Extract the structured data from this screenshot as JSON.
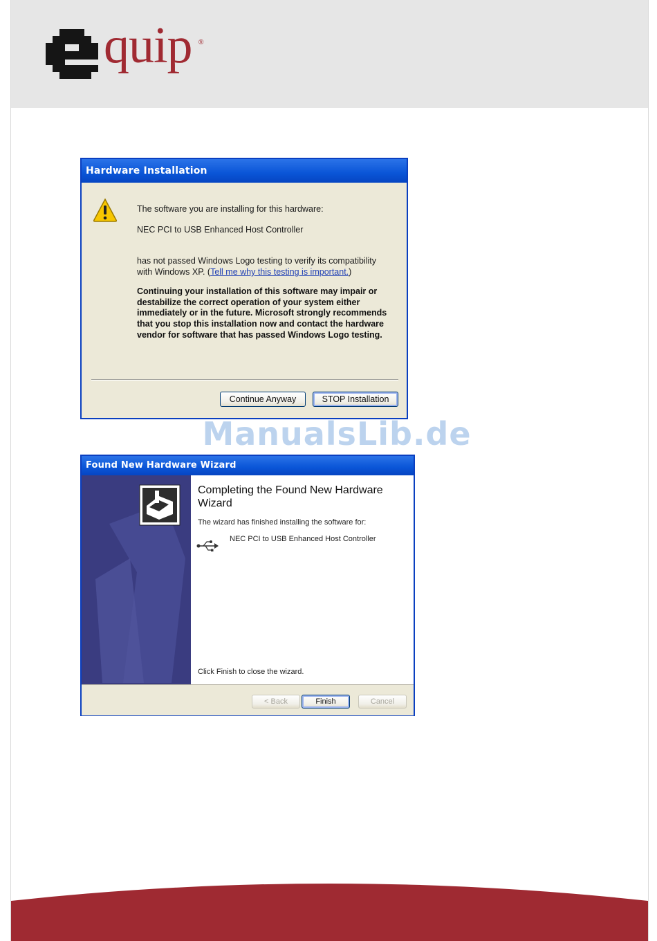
{
  "brand": {
    "name": "quip",
    "mark": "e",
    "registered": "®"
  },
  "watermark": "ManualsLib.de",
  "dialog1": {
    "title": "Hardware Installation",
    "line1": "The software you are installing for this hardware:",
    "device": "NEC PCI to USB Enhanced Host Controller",
    "para_text": "has not passed Windows Logo testing to verify its compatibility with Windows XP. (",
    "para_link": "Tell me why this testing is important.",
    "para_end": ")",
    "warning": "Continuing your installation of this software may impair or destabilize the correct operation of your system either immediately or in the future. Microsoft strongly recommends that you stop this installation now and contact the hardware vendor for software that has passed Windows Logo testing.",
    "buttons": {
      "continue": "Continue Anyway",
      "stop": "STOP Installation"
    }
  },
  "dialog2": {
    "title": "Found New Hardware Wizard",
    "heading": "Completing the Found New Hardware Wizard",
    "finished": "The wizard has finished installing the software for:",
    "device": "NEC PCI to USB Enhanced Host Controller",
    "close_hint": "Click Finish to close the wizard.",
    "buttons": {
      "back": "< Back",
      "finish": "Finish",
      "cancel": "Cancel"
    }
  }
}
